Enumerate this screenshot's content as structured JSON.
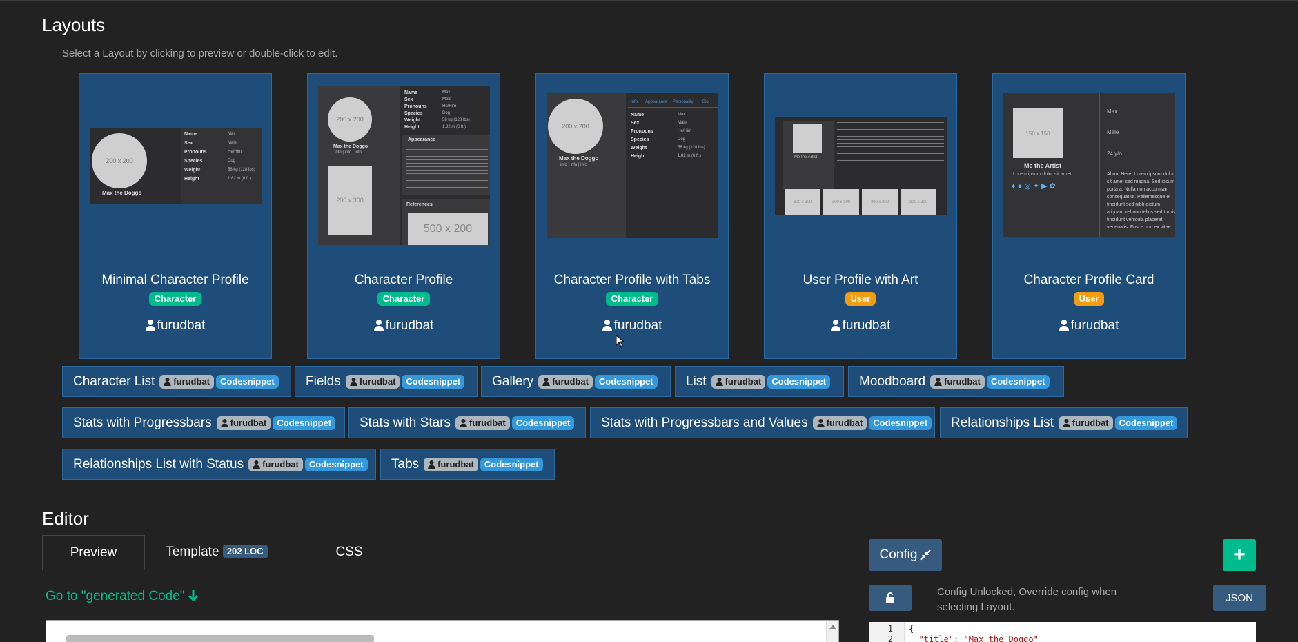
{
  "layouts": {
    "title": "Layouts",
    "subtitle": "Select a Layout by clicking to preview or double-click to edit.",
    "cards": [
      {
        "title": "Minimal Character Profile",
        "badge": "Character",
        "author": "furudbat",
        "thumb": {
          "circle": "200 x 200",
          "name": "Max the Doggo",
          "rows": [
            [
              "Name",
              "Max"
            ],
            [
              "Sex",
              "Male"
            ],
            [
              "Pronouns",
              "He/Him"
            ],
            [
              "Species",
              "Dog"
            ],
            [
              "Weight",
              "58 kg (128 lbs)"
            ],
            [
              "Height",
              "1.82 m (6 ft.)"
            ]
          ]
        }
      },
      {
        "title": "Character Profile",
        "badge": "Character",
        "author": "furudbat",
        "thumb": {
          "circle": "200 x 200",
          "name": "Max the Doggo",
          "links": "info | info | info",
          "ph": "200 x 300",
          "section1": "Appearance",
          "section2": "References",
          "ph2": "500 x 200",
          "rows": [
            [
              "Name",
              "Max"
            ],
            [
              "Sex",
              "Male"
            ],
            [
              "Pronouns",
              "He/Him"
            ],
            [
              "Species",
              "Dog"
            ],
            [
              "Weight",
              "58 kg (128 lbs)"
            ],
            [
              "Height",
              "1.82 m (6 ft.)"
            ]
          ]
        }
      },
      {
        "title": "Character Profile with Tabs",
        "badge": "Character",
        "author": "furudbat",
        "thumb": {
          "circle": "200 x 200",
          "name": "Max the Doggo",
          "links": "info | info | info",
          "tabs": [
            "Info",
            "Appearance",
            "Personality",
            "Bio"
          ],
          "rows": [
            [
              "Name",
              "Max"
            ],
            [
              "Sex",
              "Male"
            ],
            [
              "Pronouns",
              "He/Him"
            ],
            [
              "Species",
              "Dog"
            ],
            [
              "Weight",
              "58 kg (128 lbs)"
            ],
            [
              "Height",
              "1.82 m (6 ft.)"
            ]
          ]
        }
      },
      {
        "title": "User Profile with Art",
        "badge": "User",
        "author": "furudbat",
        "thumb": {
          "name": "Me the Artist",
          "ph": "300 x 300"
        }
      },
      {
        "title": "Character Profile Card",
        "badge": "User",
        "author": "furudbat",
        "thumb": {
          "ph": "150 x 150",
          "name": "Me the Artist",
          "sub": "Lorem ipsum dolor sit amet",
          "fields": [
            "Max",
            "Male",
            "24 y/o"
          ],
          "about": "About Here. Lorem ipsum dolor sit amet sed magna. Sed ipsum porta a. Nulla non accumsan consequat ut. Pellentesque et tincidunt sed nibh dictum aliquam vel non tellus sed turpis tincidunt vehicula placerat venenatis. Fusce non ex vitae vehicula. Suspendisse fauci"
        }
      }
    ]
  },
  "snippets": [
    {
      "label": "Character List",
      "author": "furudbat",
      "tag": "Codesnippet"
    },
    {
      "label": "Fields",
      "author": "furudbat",
      "tag": "Codesnippet"
    },
    {
      "label": "Gallery",
      "author": "furudbat",
      "tag": "Codesnippet"
    },
    {
      "label": "List",
      "author": "furudbat",
      "tag": "Codesnippet"
    },
    {
      "label": "Moodboard",
      "author": "furudbat",
      "tag": "Codesnippet"
    },
    {
      "label": "Stats with Progressbars",
      "author": "furudbat",
      "tag": "Codesnippet"
    },
    {
      "label": "Stats with Stars",
      "author": "furudbat",
      "tag": "Codesnippet"
    },
    {
      "label": "Stats with Progressbars and Values",
      "author": "furudbat",
      "tag": "Codesnippet"
    },
    {
      "label": "Relationships List",
      "author": "furudbat",
      "tag": "Codesnippet"
    },
    {
      "label": "Relationships List with Status",
      "author": "furudbat",
      "tag": "Codesnippet"
    },
    {
      "label": "Tabs",
      "author": "furudbat",
      "tag": "Codesnippet"
    }
  ],
  "editor": {
    "title": "Editor",
    "tabs": {
      "preview": "Preview",
      "template": "Template",
      "template_badge": "202 LOC",
      "css": "CSS"
    },
    "goto": "Go to \"generated Code\"",
    "config_label": "Config",
    "plus_label": "+",
    "config_note": "Config Unlocked, Override config when selecting Layout.",
    "json_label": "JSON",
    "code": {
      "line1_no": "1",
      "line2_no": "2",
      "line1": "{",
      "line2_key": "\"title\"",
      "line2_value": "\"Max the Doggo\""
    }
  },
  "icons": {
    "person": "user-icon",
    "arrow": "arrow-down-icon",
    "compress": "compress-icon",
    "lock": "unlock-icon"
  },
  "colors": {
    "bg": "#222222",
    "card": "#1e4d79",
    "success": "#00bc8c",
    "warning": "#f39c12",
    "info": "#3498db",
    "primary": "#375a7f"
  }
}
